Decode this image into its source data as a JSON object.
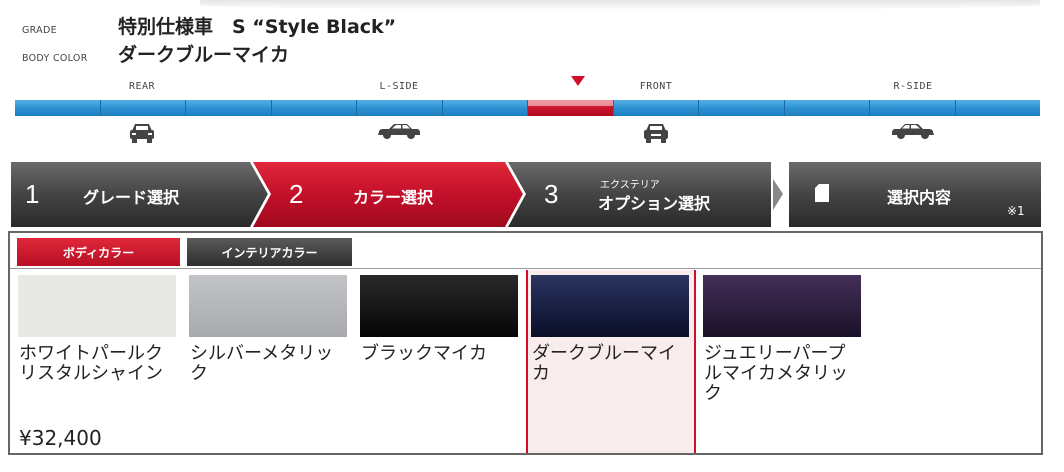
{
  "header": {
    "grade_label": "GRADE",
    "grade_value": "特別仕様車　S “Style Black”",
    "body_color_label": "BODY COLOR",
    "body_color_value": "ダークブルーマイカ"
  },
  "views": {
    "items": [
      {
        "label": "REAR",
        "icon": "car-rear-icon"
      },
      {
        "label": "L-SIDE",
        "icon": "car-side-icon"
      },
      {
        "label": "FRONT",
        "icon": "car-front-icon"
      },
      {
        "label": "R-SIDE",
        "icon": "car-side-icon"
      }
    ],
    "active": "FRONT",
    "bar_color": "#2a8fd1",
    "active_color": "#c5102a"
  },
  "steps": [
    {
      "number": "1",
      "label": "グレード選択",
      "state": "done"
    },
    {
      "number": "2",
      "label": "カラー選択",
      "state": "current"
    },
    {
      "number": "3",
      "label_small": "エクステリア",
      "label": "オプション選択",
      "state": "next"
    },
    {
      "label": "選択内容",
      "note": "※1",
      "icon": "document-icon"
    }
  ],
  "tabs": {
    "body_color": "ボディカラー",
    "interior_color": "インテリアカラー",
    "active": "body_color"
  },
  "colors": [
    {
      "name": "ホワイトパールクリスタルシャイン",
      "price": "¥32,400",
      "swatch": "#e8e8e4",
      "selected": false
    },
    {
      "name": "シルバーメタリック",
      "price": "",
      "swatch": "#b4b6b9",
      "selected": false
    },
    {
      "name": "ブラックマイカ",
      "price": "",
      "swatch": "#111111",
      "selected": false
    },
    {
      "name": "ダークブルーマイカ",
      "price": "",
      "swatch": "#1e2448",
      "selected": true
    },
    {
      "name": "ジュエリーパープルマイカメタリック",
      "price": "",
      "swatch": "#2e2240",
      "selected": false
    }
  ]
}
